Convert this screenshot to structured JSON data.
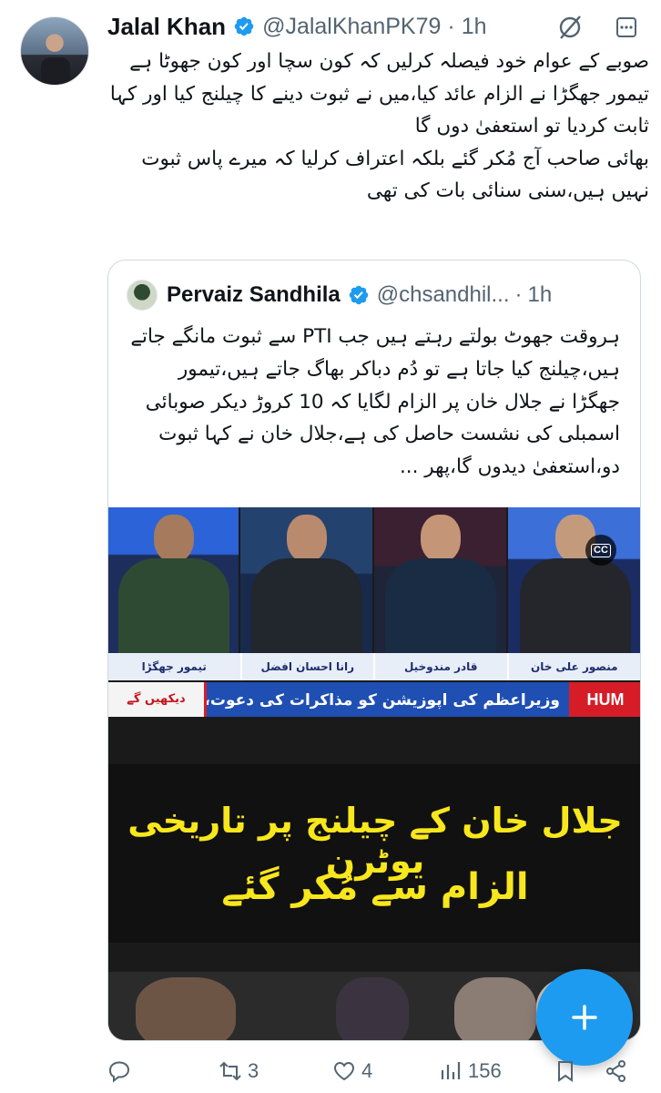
{
  "tweet": {
    "author_name": "Jalal Khan",
    "handle": "@JalalKhanPK79",
    "separator": "·",
    "time": "1h",
    "text": "صوبے کے عوام خود فیصلہ کرلیں کہ کون سچا اور کون جھوٹا ہے\nتیمور جھگڑا نے الزام عائد کیا،میں نے ثبوت دینے کا چیلنج کیا اور کہا ثابت کردیا تو استعفیٰ دوں گا\nبھائی صاحب آج مُکر گئے بلکہ اعتراف کرلیا کہ میرے پاس ثبوت نہیں ہیں،سنی سنائی بات کی تھی"
  },
  "quoted_tweet": {
    "author_name": "Pervaiz Sandhila",
    "handle": "@chsandhil...",
    "separator": "·",
    "time": "1h",
    "text": "ہروقت جھوٹ بولتے رہتے ہیں جب PTI سے ثبوت مانگے جاتے ہیں،چیلنج کیا جاتا ہے تو دُم دباکر بھاگ جاتے ہیں،تیمور جھگڑا نے جلال خان پر الزام لگایا کہ 10 کروڑ دیکر صوبائی اسمبلی کی نشست حاصل کی ہے،جلال خان نے کہا ثبوت دو،استعفیٰ دیدوں گا،پھر ..."
  },
  "media": {
    "panel_names": [
      "تیمور جھگڑا",
      "رانا احسان افضل",
      "قادر مندوخیل",
      "منصور علی خان"
    ],
    "ticker_left": "دیکھیں گے",
    "ticker_text": "وزیراعظم کی اپوزیشن کو مذاکرات کی دعوت، رکاوٹ کہاں؟",
    "ticker_logo": "HUM",
    "cc_label": "CC",
    "banner_line1": "جلال خان کے چیلنج پر تاریخی یوٹرن",
    "banner_line2": "الزام سے مُکر گئے"
  },
  "actions": {
    "reply_count": "",
    "retweet_count": "3",
    "like_count": "4",
    "views_count": "156"
  },
  "icons": {
    "verified": "verified-badge-icon",
    "grok": "grok-icon",
    "more": "more-icon",
    "reply": "reply-icon",
    "retweet": "retweet-icon",
    "like": "like-icon",
    "views": "views-icon",
    "bookmark": "bookmark-icon",
    "share": "share-icon",
    "compose": "compose-icon"
  },
  "colors": {
    "accent": "#1d9bf0",
    "muted": "#536471",
    "banner_text": "#f8e71c"
  }
}
